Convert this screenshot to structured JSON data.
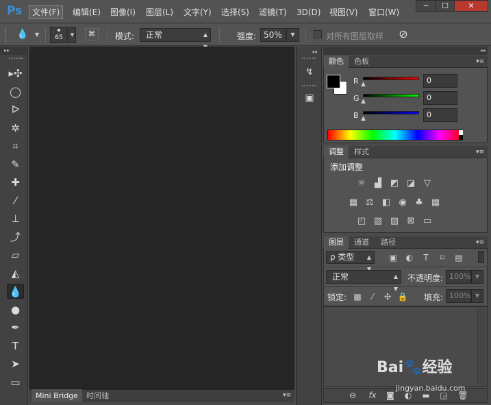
{
  "app": {
    "logo": "Ps"
  },
  "menu": {
    "items": [
      "文件(F)",
      "编辑(E)",
      "图像(I)",
      "图层(L)",
      "文字(Y)",
      "选择(S)",
      "滤镜(T)",
      "3D(D)",
      "视图(V)",
      "窗口(W)"
    ],
    "active_index": 0
  },
  "window_controls": {
    "minimize": "─",
    "maximize": "☐",
    "close": "✕"
  },
  "options_bar": {
    "brush_size": "65",
    "mode_label": "模式:",
    "mode_value": "正常",
    "strength_label": "强度:",
    "strength_value": "50%",
    "sample_all_label": "对所有图层取样"
  },
  "tools": [
    {
      "icon": "move-icon",
      "glyph": "▸✣"
    },
    {
      "icon": "marquee-icon",
      "glyph": "◯"
    },
    {
      "icon": "lasso-icon",
      "glyph": "ᐅ"
    },
    {
      "icon": "magic-wand-icon",
      "glyph": "✲"
    },
    {
      "icon": "crop-icon",
      "glyph": "⌗"
    },
    {
      "icon": "eyedropper-icon",
      "glyph": "✎"
    },
    {
      "icon": "healing-brush-icon",
      "glyph": "✚"
    },
    {
      "icon": "brush-icon",
      "glyph": "⁄"
    },
    {
      "icon": "stamp-icon",
      "glyph": "⊥"
    },
    {
      "icon": "history-brush-icon",
      "glyph": "⤴"
    },
    {
      "icon": "eraser-icon",
      "glyph": "▱"
    },
    {
      "icon": "paint-bucket-icon",
      "glyph": "◭"
    },
    {
      "icon": "blur-icon",
      "glyph": "💧"
    },
    {
      "icon": "dodge-icon",
      "glyph": "●"
    },
    {
      "icon": "pen-icon",
      "glyph": "✒"
    },
    {
      "icon": "type-icon",
      "glyph": "T"
    },
    {
      "icon": "path-select-icon",
      "glyph": "➤"
    },
    {
      "icon": "rectangle-icon",
      "glyph": "▭"
    }
  ],
  "selected_tool_index": 12,
  "bottom_tabs": [
    "Mini Bridge",
    "时间轴"
  ],
  "color_panel": {
    "tabs": [
      "颜色",
      "色板"
    ],
    "channels": [
      {
        "label": "R",
        "value": "0",
        "color": "#e02020"
      },
      {
        "label": "G",
        "value": "0",
        "color": "#20c020"
      },
      {
        "label": "B",
        "value": "0",
        "color": "#2020e0"
      }
    ]
  },
  "adjust_panel": {
    "tabs": [
      "调整",
      "样式"
    ],
    "title": "添加调整"
  },
  "layers_panel": {
    "tabs": [
      "图层",
      "通道",
      "路径"
    ],
    "filter_label": "ρ 类型",
    "blend_mode": "正常",
    "opacity_label": "不透明度:",
    "opacity_value": "100%",
    "lock_label": "锁定:",
    "fill_label": "填充:",
    "fill_value": "100%"
  },
  "watermark": {
    "brand": "Bai🐾经验",
    "url": "jingyan.baidu.com"
  }
}
